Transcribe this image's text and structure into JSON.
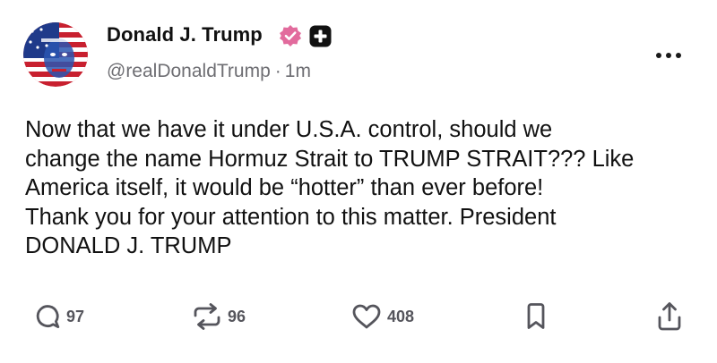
{
  "post": {
    "author": {
      "display_name": "Donald J. Trump",
      "handle": "@realDonaldTrump",
      "separator": "·",
      "time": "1m",
      "verified_color": "#e26b9d",
      "avatar_icon": "flag-painted-portrait-avatar"
    },
    "body": {
      "lines": [
        "Now that we have it under U.S.A. control, should we",
        "change the name Hormuz Strait to TRUMP STRAIT??? Like",
        "America itself, it would be “hotter” than ever before!",
        "Thank you for your attention to this matter. President",
        "DONALD J. TRUMP"
      ]
    },
    "actions": {
      "reply_count": "97",
      "repost_count": "96",
      "like_count": "408",
      "icons": [
        "reply-icon",
        "repost-icon",
        "heart-icon",
        "bookmark-icon",
        "share-icon"
      ]
    }
  }
}
